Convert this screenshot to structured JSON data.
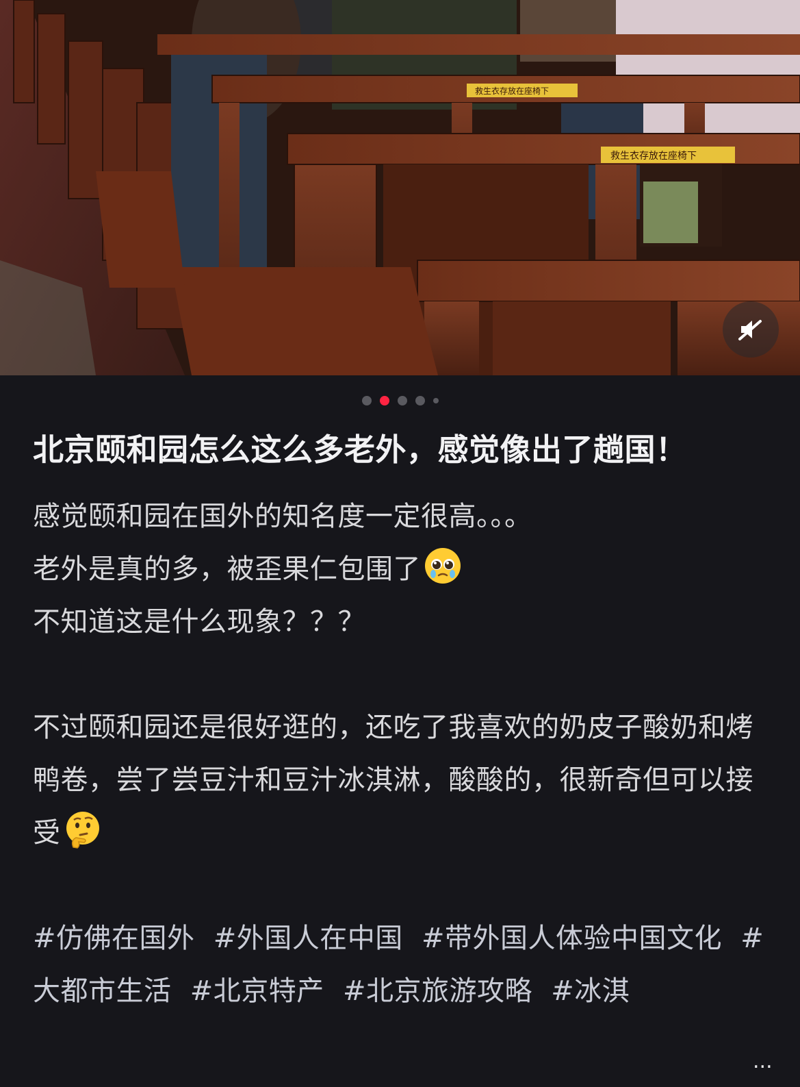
{
  "carousel": {
    "total": 5,
    "active_index": 1,
    "photo_signs": [
      "救生衣存放在座椅下",
      "救生衣存放在座椅下"
    ]
  },
  "post": {
    "title": "北京颐和园怎么这么多老外，感觉像出了趟国！",
    "lines": [
      "感觉颐和园在国外的知名度一定很高。。。",
      "老外是真的多，被歪果仁包围了",
      "不知道这是什么现象？？？",
      "",
      "不过颐和园还是很好逛的，还吃了我喜欢的奶皮子酸奶和烤鸭卷，尝了尝豆汁和豆汁冰淇淋，酸酸的，很新奇但可以接受"
    ],
    "tags": [
      "#仿佛在国外",
      "#外国人在中国",
      "#带外国人体验中国文化",
      "#大都市生活",
      "#北京特产",
      "#北京旅游攻略",
      "#冰淇"
    ],
    "more_label": "..."
  },
  "colors": {
    "background": "#16161b",
    "accent_dot": "#ff2442",
    "inactive_dot": "#5a5a60",
    "title": "#f2f2f4",
    "body": "#d9d9dc"
  },
  "icons": {
    "mute": "speaker-muted-icon",
    "emoji_1": "pleading-face-emoji",
    "emoji_2": "thinking-face-emoji"
  }
}
